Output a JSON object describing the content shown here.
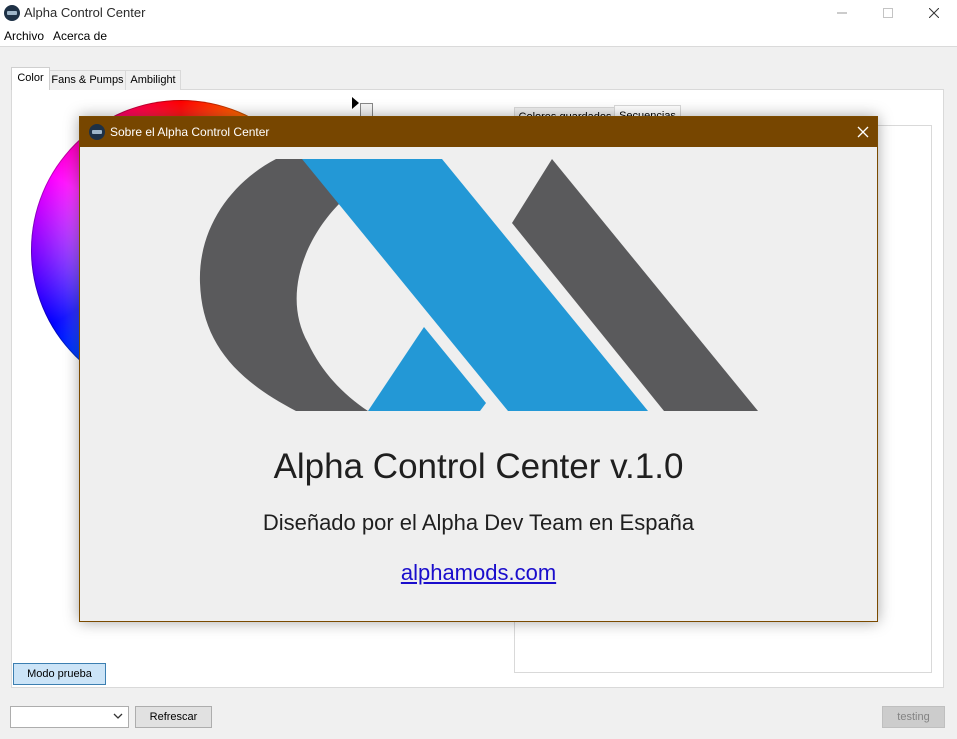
{
  "window": {
    "title": "Alpha Control Center",
    "icon": "alpha-app-icon",
    "controls": [
      "minimize-icon",
      "maximize-icon",
      "close-icon"
    ]
  },
  "menu": {
    "archivo": "Archivo",
    "acerca": "Acerca de"
  },
  "tabs": {
    "color": "Color",
    "fans": "Fans & Pumps",
    "ambilight": "Ambilight"
  },
  "right_tabs": {
    "colores": "Colores guardados",
    "secuencias": "Secuencias"
  },
  "buttons": {
    "modo_prueba": "Modo prueba",
    "refrescar": "Refrescar",
    "testing": "testing"
  },
  "device_select": {
    "value": ""
  },
  "dialog": {
    "title": "Sobre el Alpha Control Center",
    "heading": "Alpha Control Center v.1.0",
    "subtitle": "Diseñado por el Alpha Dev Team en España",
    "link": "alphamods.com",
    "logo": "alpha-logo",
    "colors": {
      "titlebar": "#774600",
      "logo_gray": "#5a5a5c",
      "logo_blue": "#2398d6"
    }
  }
}
